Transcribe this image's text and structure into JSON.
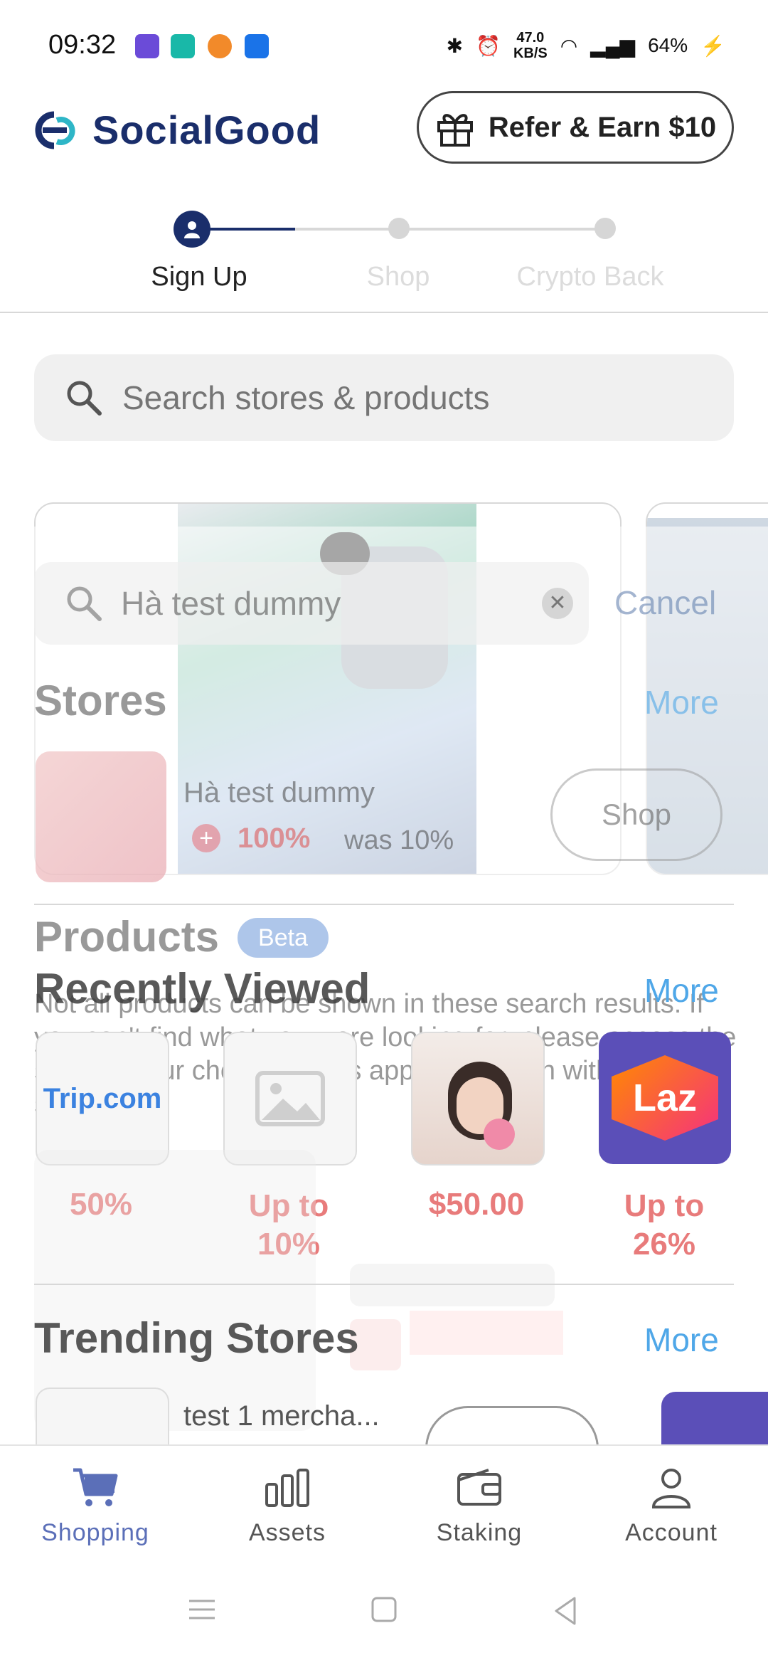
{
  "status": {
    "time": "09:32",
    "speed_top": "47.0",
    "speed_unit": "KB/S",
    "battery": "64%"
  },
  "header": {
    "logo_text": "SocialGood",
    "refer_label": "Refer & Earn $10"
  },
  "stepper": {
    "steps": [
      "Sign Up",
      "Shop",
      "Crypto Back"
    ]
  },
  "search": {
    "placeholder": "Search stores & products"
  },
  "overlay": {
    "query": "Hà test dummy",
    "cancel": "Cancel",
    "stores_title": "Stores",
    "more": "More",
    "store_name": "Hà test dummy",
    "store_rate_new": "100%",
    "store_rate_was": "was 10%",
    "shop_btn": "Shop",
    "products_title": "Products",
    "beta": "Beta",
    "products_note": "Not all products can be shown in these search results. If you can't find what you were looking for, please access the store of your choice via this app and search within their site."
  },
  "recent": {
    "title": "Recently Viewed",
    "more": "More",
    "items": [
      {
        "label": "Trip.com",
        "value": "50%"
      },
      {
        "label": "",
        "value": "Up to 10%"
      },
      {
        "label": "",
        "value": "$50.00"
      },
      {
        "label": "Laz",
        "value": "Up to 26%"
      }
    ]
  },
  "trending": {
    "title": "Trending Stores",
    "more": "More",
    "first_store": "test 1 mercha..."
  },
  "nav": {
    "items": [
      "Shopping",
      "Assets",
      "Staking",
      "Account"
    ]
  },
  "colors": {
    "brand": "#1a2e6b",
    "accent": "#4fa7e8",
    "discount": "#e87b7b",
    "lazada": "#5b4fb8"
  }
}
